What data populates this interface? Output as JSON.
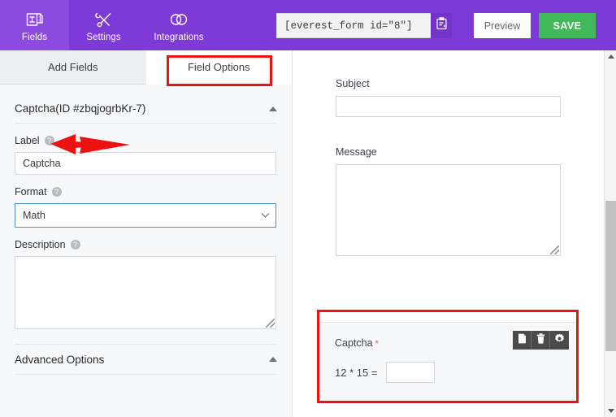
{
  "topbar": {
    "tabs": [
      {
        "label": "Fields",
        "icon": "fields-icon",
        "active": true
      },
      {
        "label": "Settings",
        "icon": "tools-icon",
        "active": false
      },
      {
        "label": "Integrations",
        "icon": "integrations-icon",
        "active": false
      }
    ],
    "shortcode_value": "[everest_form id=\"8\"]",
    "copy_icon": "clipboard-copy-icon",
    "preview_label": "Preview",
    "save_label": "SAVE",
    "bg_color": "#7e3ad6",
    "save_color": "#41b85a"
  },
  "sidebar": {
    "tabs": [
      {
        "label": "Add Fields",
        "active": false
      },
      {
        "label": "Field Options",
        "active": true
      }
    ],
    "section": {
      "title": "Captcha(ID #zbqjogrbKr-7)",
      "collapse_icon": "caret-up-icon"
    },
    "fields": {
      "label_title": "Label",
      "label_value": "Captcha",
      "format_title": "Format",
      "format_value": "Math",
      "format_options": [
        "Math"
      ],
      "description_title": "Description",
      "description_value": "",
      "help_icon": "help-circle-icon"
    },
    "advanced": {
      "title": "Advanced Options",
      "collapse_icon": "caret-up-icon"
    }
  },
  "preview": {
    "subject_label": "Subject",
    "subject_value": "",
    "message_label": "Message",
    "message_value": "",
    "captcha": {
      "label": "Captcha",
      "required_mark": "*",
      "equation": "12 * 15 =",
      "answer_value": "",
      "tools": [
        {
          "name": "duplicate-icon"
        },
        {
          "name": "trash-icon"
        },
        {
          "name": "gear-icon"
        }
      ],
      "tools_bg": "#4a4a4a"
    }
  },
  "annotations": {
    "color": "#ee1111",
    "field_options_box": true,
    "captcha_box": true,
    "label_arrow": true
  },
  "scrollbar": {
    "up_icon": "scroll-up-arrow",
    "down_icon": "scroll-down-arrow",
    "thumb_color": "#c2c2c2"
  }
}
